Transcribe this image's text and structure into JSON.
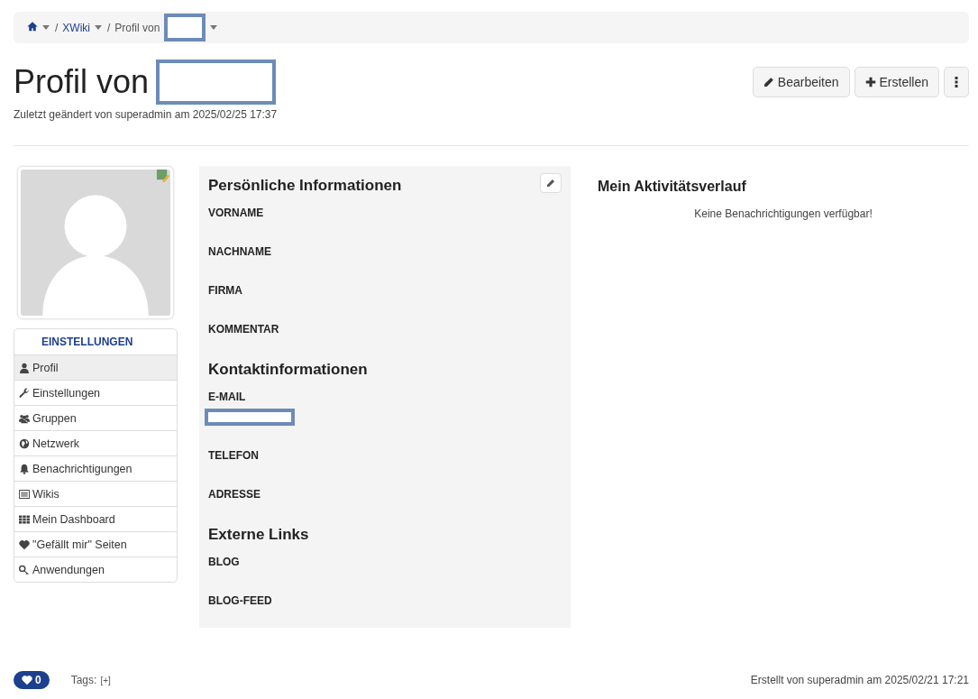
{
  "breadcrumb": [
    {
      "kind": "home",
      "dropdown": true
    },
    {
      "kind": "link",
      "separator": "/",
      "label": "XWiki",
      "dropdown": true
    },
    {
      "kind": "text",
      "separator": "/",
      "label": "Profil von",
      "redacted": true,
      "dropdown": true
    }
  ],
  "page": {
    "title": "Profil von",
    "title_redacted": true,
    "subtitle": "Zuletzt geändert von superadmin am 2025/02/25 17:37"
  },
  "actions": [
    {
      "kind": "edit",
      "label": "Bearbeiten"
    },
    {
      "kind": "create",
      "label": "Erstellen"
    },
    {
      "kind": "more"
    }
  ],
  "sidebar": {
    "heading": "EINSTELLUNGEN",
    "items": [
      {
        "label": "Profil",
        "selected": true
      },
      {
        "label": "Einstellungen",
        "selected": false
      },
      {
        "label": "Gruppen",
        "selected": false
      },
      {
        "label": "Netzwerk",
        "selected": false
      },
      {
        "label": "Benachrichtigungen",
        "selected": false
      },
      {
        "label": "Wikis",
        "selected": false
      },
      {
        "label": "Mein Dashboard",
        "selected": false
      },
      {
        "label": "\"Gefällt mir\" Seiten",
        "selected": false
      },
      {
        "label": "Anwendungen",
        "selected": false
      }
    ]
  },
  "sections": [
    {
      "title": "Persönliche Informationen",
      "editable": true,
      "fields": [
        {
          "label": "VORNAME",
          "redacted": false
        },
        {
          "label": "NACHNAME",
          "redacted": false
        },
        {
          "label": "FIRMA",
          "redacted": false
        },
        {
          "label": "KOMMENTAR",
          "redacted": false
        }
      ]
    },
    {
      "title": "Kontaktinformationen",
      "editable": false,
      "fields": [
        {
          "label": "E-MAIL",
          "redacted": true
        },
        {
          "label": "TELEFON",
          "redacted": false
        },
        {
          "label": "ADRESSE",
          "redacted": false
        }
      ]
    },
    {
      "title": "Externe Links",
      "editable": false,
      "fields": [
        {
          "label": "BLOG",
          "redacted": false
        },
        {
          "label": "BLOG-FEED",
          "redacted": false
        }
      ]
    }
  ],
  "activity": {
    "title": "Mein Aktivitätsverlauf",
    "empty_message": "Keine Benachrichtigungen verfügbar!"
  },
  "footer": {
    "likes": "0",
    "tags_label": "Tags:",
    "tags_add": "[+]",
    "created": "Erstellt von superadmin am 2025/02/21 17:21"
  }
}
